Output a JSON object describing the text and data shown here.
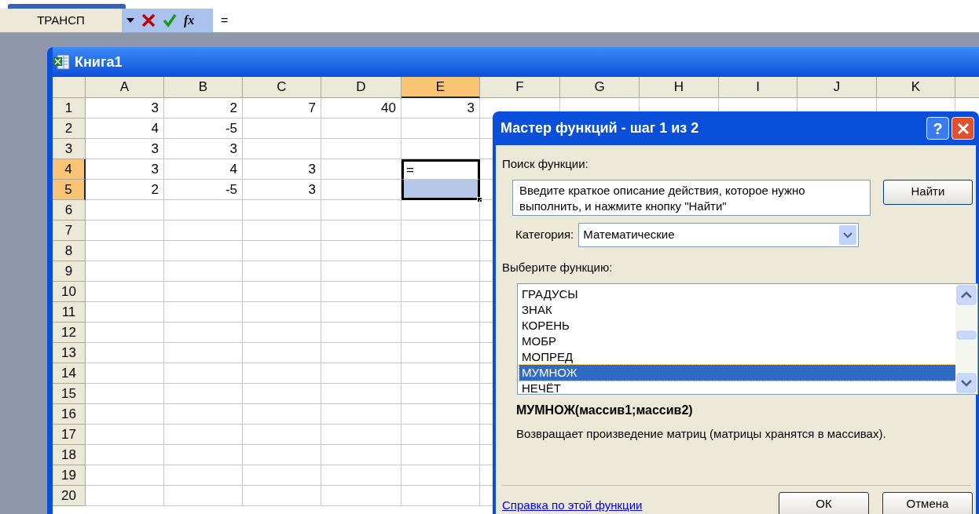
{
  "formula_bar": {
    "name_box": "ТРАНСП",
    "fx_label": "fx",
    "value": "="
  },
  "workbook": {
    "title": "Книга1",
    "columns": [
      {
        "label": "A",
        "selected": false
      },
      {
        "label": "B",
        "selected": false
      },
      {
        "label": "C",
        "selected": false
      },
      {
        "label": "D",
        "selected": false
      },
      {
        "label": "E",
        "selected": true
      },
      {
        "label": "F",
        "selected": false
      },
      {
        "label": "G",
        "selected": false
      },
      {
        "label": "H",
        "selected": false
      },
      {
        "label": "I",
        "selected": false
      },
      {
        "label": "J",
        "selected": false
      },
      {
        "label": "K",
        "selected": false
      }
    ],
    "rows": [
      {
        "label": "1",
        "selected": false,
        "cells": [
          "3",
          "2",
          "7",
          "40",
          "3"
        ]
      },
      {
        "label": "2",
        "selected": false,
        "cells": [
          "4",
          "-5",
          null,
          null,
          null
        ]
      },
      {
        "label": "3",
        "selected": false,
        "cells": [
          "3",
          "3",
          null,
          null,
          null
        ]
      },
      {
        "label": "4",
        "selected": true,
        "cells": [
          "3",
          "4",
          "3",
          null,
          "="
        ]
      },
      {
        "label": "5",
        "selected": true,
        "cells": [
          "2",
          "-5",
          "3",
          null,
          null
        ]
      },
      {
        "label": "6",
        "selected": false
      },
      {
        "label": "7",
        "selected": false
      },
      {
        "label": "8",
        "selected": false
      },
      {
        "label": "9",
        "selected": false
      },
      {
        "label": "10",
        "selected": false
      },
      {
        "label": "11",
        "selected": false
      },
      {
        "label": "12",
        "selected": false
      },
      {
        "label": "13",
        "selected": false
      },
      {
        "label": "14",
        "selected": false
      },
      {
        "label": "15",
        "selected": false
      },
      {
        "label": "16",
        "selected": false
      },
      {
        "label": "17",
        "selected": false
      },
      {
        "label": "18",
        "selected": false
      },
      {
        "label": "19",
        "selected": false
      },
      {
        "label": "20",
        "selected": false
      }
    ]
  },
  "dialog": {
    "title": "Мастер функций - шаг 1 из 2",
    "help_label": "?",
    "search_label": "Поиск функции:",
    "search_value": "Введите краткое описание действия, которое нужно выполнить, и нажмите кнопку \"Найти\"",
    "find_button": "Найти",
    "category_label": "Категория:",
    "category_value": "Математические",
    "list_label": "Выберите функцию:",
    "functions": [
      {
        "label": "ГРАДУСЫ",
        "selected": false
      },
      {
        "label": "ЗНАК",
        "selected": false
      },
      {
        "label": "КОРЕНЬ",
        "selected": false
      },
      {
        "label": "МОБР",
        "selected": false
      },
      {
        "label": "МОПРЕД",
        "selected": false
      },
      {
        "label": "МУМНОЖ",
        "selected": true
      },
      {
        "label": "НЕЧЁТ",
        "selected": false
      }
    ],
    "signature": "МУМНОЖ(массив1;массив2)",
    "description": "Возвращает произведение матриц (матрицы хранятся в массивах).",
    "help_link": "Справка по этой функции",
    "buttons": [
      "ОК",
      "Отмена"
    ]
  }
}
